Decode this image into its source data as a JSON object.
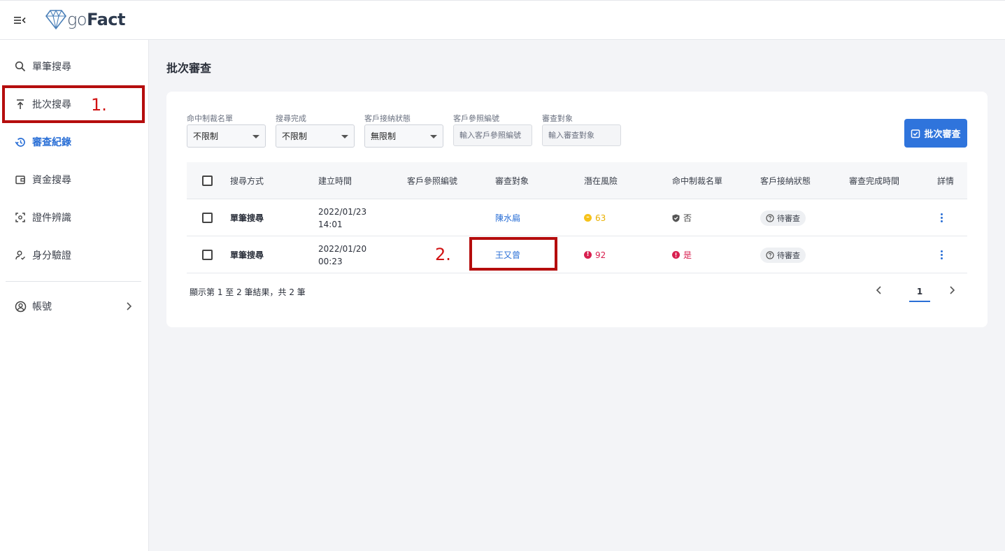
{
  "app": {
    "logo_go": "go",
    "logo_fact": "Fact"
  },
  "sidebar": {
    "items": [
      {
        "label": "單筆搜尋",
        "icon": "search-icon"
      },
      {
        "label": "批次搜尋",
        "icon": "upload-icon"
      },
      {
        "label": "審查紀錄",
        "icon": "history-icon",
        "active": true
      },
      {
        "label": "資金搜尋",
        "icon": "wallet-icon"
      },
      {
        "label": "證件辨識",
        "icon": "scan-icon"
      },
      {
        "label": "身分驗證",
        "icon": "user-check-icon"
      }
    ],
    "account": {
      "label": "帳號",
      "icon": "account-icon"
    }
  },
  "annotations": {
    "one": "1.",
    "two": "2."
  },
  "page": {
    "title": "批次審查"
  },
  "filters": {
    "sanction_list": {
      "label": "命中制裁名單",
      "value": "不限制"
    },
    "search_complete": {
      "label": "搜尋完成",
      "value": "不限制"
    },
    "client_status": {
      "label": "客戶接納狀態",
      "value": "無限制"
    },
    "client_ref": {
      "label": "客戶參照編號",
      "placeholder": "輸入客戶參照編號"
    },
    "subject": {
      "label": "審查對象",
      "placeholder": "輸入審查對象"
    }
  },
  "actions": {
    "batch_review": "批次審查"
  },
  "table": {
    "headers": {
      "method": "搜尋方式",
      "created": "建立時間",
      "client_ref": "客戶參照編號",
      "subject": "審查對象",
      "risk": "潛在風險",
      "sanction": "命中制裁名單",
      "status": "客戶接納狀態",
      "completed": "審查完成時間",
      "detail": "詳情"
    },
    "rows": [
      {
        "method": "單筆搜尋",
        "date": "2022/01/23",
        "time": "14:01",
        "client_ref": "",
        "subject": "陳水扁",
        "risk": "63",
        "risk_level": "medium",
        "sanction": "否",
        "status": "待審查",
        "completed": ""
      },
      {
        "method": "單筆搜尋",
        "date": "2022/01/20",
        "time": "00:23",
        "client_ref": "",
        "subject": "王又曾",
        "risk": "92",
        "risk_level": "high",
        "sanction": "是",
        "status": "待審查",
        "completed": ""
      }
    ]
  },
  "pagination": {
    "summary": "顯示第 1 至 2 筆結果，共 2 筆",
    "current": "1"
  },
  "colors": {
    "primary": "#2f74dc",
    "medium_risk": "#f6c21a",
    "high_risk": "#d81f4f",
    "annotation": "#b50d0d"
  }
}
